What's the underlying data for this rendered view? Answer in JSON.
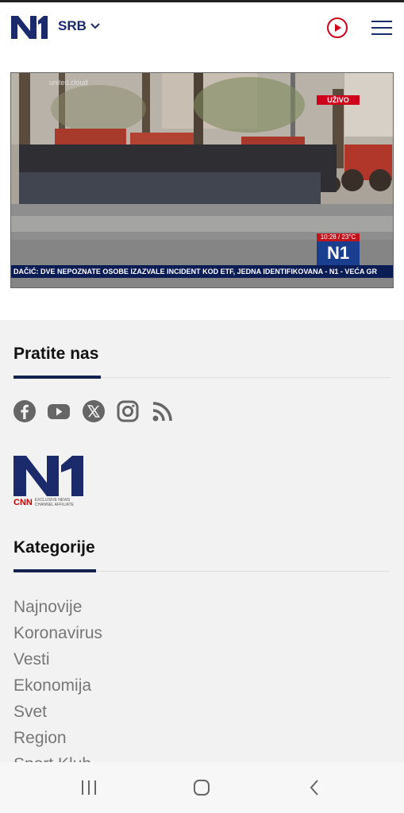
{
  "header": {
    "logo_text": "N1",
    "region_label": "SRB",
    "icons": [
      "play-circle-icon",
      "hamburger-menu-icon"
    ]
  },
  "video": {
    "live_badge": "UŽIVO",
    "watermark": "united.cloud",
    "time_temp": "10:28 / 23°C",
    "channel_logo": "N1",
    "ticker": "DAČIĆ: DVE NEPOZNATE OSOBE IZAZVALE INCIDENT KOD ETF, JEDNA IDENTIFIKOVANA - N1 - VEĆA GR"
  },
  "follow": {
    "title": "Pratite nas",
    "icons": [
      "facebook-icon",
      "youtube-icon",
      "x-twitter-icon",
      "instagram-icon",
      "rss-icon"
    ]
  },
  "brand": {
    "logo_text": "N1",
    "cnn_text": "CNN",
    "affiliate_line1": "EXCLUSIVE NEWS",
    "affiliate_line2": "CHANNEL AFFILIATE"
  },
  "categories": {
    "title": "Kategorije",
    "items": [
      "Najnovije",
      "Koronavirus",
      "Vesti",
      "Ekonomija",
      "Svet",
      "Region",
      "Sport Klub"
    ]
  },
  "colors": {
    "brand_blue": "#1b2a6b",
    "live_red": "#d0021b",
    "accent_dark": "#14224f"
  }
}
